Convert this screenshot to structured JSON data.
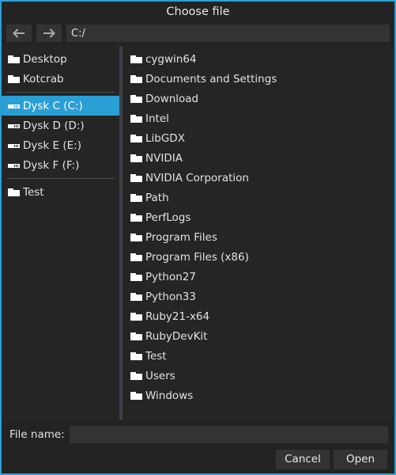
{
  "window": {
    "title": "Choose file",
    "accent_color": "#2a9fd6",
    "background_color": "#252525",
    "chrome_color": "#232323"
  },
  "navbar": {
    "back_icon": "arrow-left-icon",
    "forward_icon": "arrow-right-icon",
    "path_value": "C:/"
  },
  "sidebar": {
    "groups": [
      {
        "items": [
          {
            "label": "Desktop",
            "icon": "folder-icon",
            "selected": false
          },
          {
            "label": "Kotcrab",
            "icon": "folder-icon",
            "selected": false
          }
        ]
      },
      {
        "items": [
          {
            "label": "Dysk C (C:)",
            "icon": "drive-icon",
            "selected": true
          },
          {
            "label": "Dysk D (D:)",
            "icon": "drive-icon",
            "selected": false
          },
          {
            "label": "Dysk E (E:)",
            "icon": "drive-icon",
            "selected": false
          },
          {
            "label": "Dysk F (F:)",
            "icon": "drive-icon",
            "selected": false
          }
        ]
      },
      {
        "items": [
          {
            "label": "Test",
            "icon": "folder-icon",
            "selected": false
          }
        ]
      }
    ]
  },
  "filelist": {
    "items": [
      {
        "label": "cygwin64",
        "icon": "folder-icon"
      },
      {
        "label": "Documents and Settings",
        "icon": "folder-icon"
      },
      {
        "label": "Download",
        "icon": "folder-icon"
      },
      {
        "label": "Intel",
        "icon": "folder-icon"
      },
      {
        "label": "LibGDX",
        "icon": "folder-icon"
      },
      {
        "label": "NVIDIA",
        "icon": "folder-icon"
      },
      {
        "label": "NVIDIA Corporation",
        "icon": "folder-icon"
      },
      {
        "label": "Path",
        "icon": "folder-icon"
      },
      {
        "label": "PerfLogs",
        "icon": "folder-icon"
      },
      {
        "label": "Program Files",
        "icon": "folder-icon"
      },
      {
        "label": "Program Files (x86)",
        "icon": "folder-icon"
      },
      {
        "label": "Python27",
        "icon": "folder-icon"
      },
      {
        "label": "Python33",
        "icon": "folder-icon"
      },
      {
        "label": "Ruby21-x64",
        "icon": "folder-icon"
      },
      {
        "label": "RubyDevKit",
        "icon": "folder-icon"
      },
      {
        "label": "Test",
        "icon": "folder-icon"
      },
      {
        "label": "Users",
        "icon": "folder-icon"
      },
      {
        "label": "Windows",
        "icon": "folder-icon"
      }
    ]
  },
  "bottom": {
    "filename_label": "File name:",
    "filename_value": "",
    "cancel_label": "Cancel",
    "open_label": "Open"
  }
}
